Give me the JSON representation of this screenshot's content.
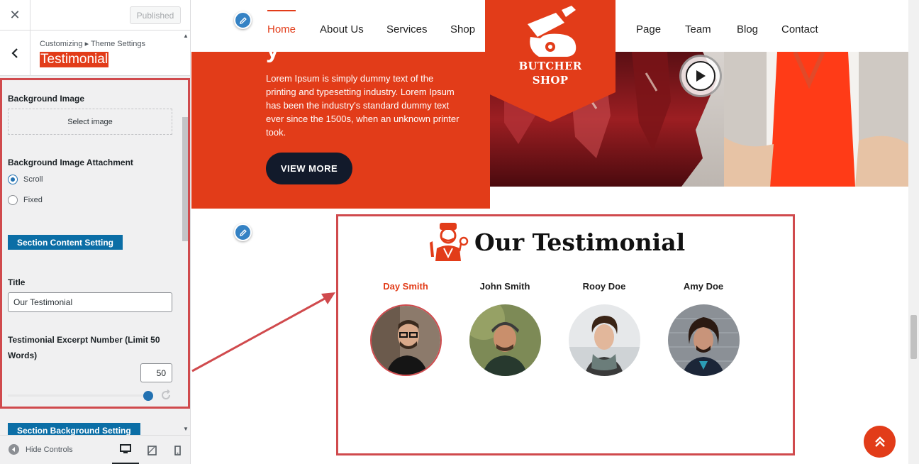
{
  "sidebar": {
    "close_glyph": "✕",
    "publish_label": "Published",
    "breadcrumb": "Customizing ▸ Theme Settings",
    "section_title": "Testimonial",
    "bg_image_label": "Background Image",
    "select_image_label": "Select image",
    "attachment_label": "Background Image Attachment",
    "attachment_options": [
      {
        "label": "Scroll",
        "checked": true
      },
      {
        "label": "Fixed",
        "checked": false
      }
    ],
    "content_setting_label": "Section Content Setting",
    "title_label": "Title",
    "title_value": "Our Testimonial",
    "excerpt_label": "Testimonial Excerpt Number (Limit 50 Words)",
    "excerpt_value": "50",
    "bg_setting_label": "Section Background Setting",
    "hide_controls_label": "Hide Controls"
  },
  "nav": {
    "items": [
      "Home",
      "About Us",
      "Services",
      "Shop",
      "Page",
      "Team",
      "Blog",
      "Contact"
    ]
  },
  "logo": {
    "line1": "BUTCHER",
    "line2": "SHOP"
  },
  "hero": {
    "partial_title": "y",
    "text": "Lorem Ipsum is simply dummy text of the printing and typesetting industry. Lorem Ipsum has been the industry's standard dummy text ever since the 1500s, when an unknown printer took.",
    "button_label": "VIEW MORE"
  },
  "testimonial": {
    "title": "Our Testimonial",
    "people": [
      {
        "name": "Day Smith",
        "active": true
      },
      {
        "name": "John Smith",
        "active": false
      },
      {
        "name": "Rooy Doe",
        "active": false
      },
      {
        "name": "Amy Doe",
        "active": false
      }
    ]
  },
  "colors": {
    "brand_red": "#e23c19",
    "wp_blue": "#0b6ea6",
    "highlight": "#d04a4d",
    "dark_button": "#121a2b"
  }
}
